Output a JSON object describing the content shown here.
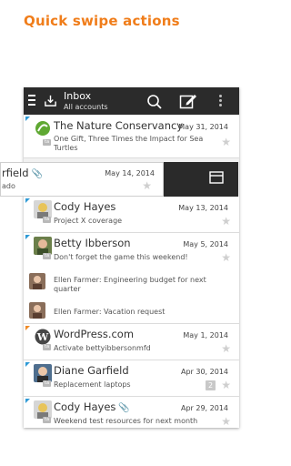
{
  "promo": {
    "title": "Quick swipe actions"
  },
  "topbar": {
    "title": "Inbox",
    "subtitle": "All accounts"
  },
  "swipe": {
    "sender": "rfield",
    "date": "May 14, 2014",
    "subject": "ado"
  },
  "messages": [
    {
      "sender": "The Nature Conservancy",
      "date": "May 31, 2014",
      "subject": "One Gift, Three Times the Impact for Sea Turtles"
    },
    {
      "sender": "Cody Hayes",
      "date": "May 13, 2014",
      "subject": "Project X coverage"
    },
    {
      "sender": "Betty Ibberson",
      "date": "May 5, 2014",
      "subject": "Don't forget the game this weekend!"
    },
    {
      "sender": "Ellen Farmer",
      "subject": "Ellen Farmer: Engineering budget for next quarter"
    },
    {
      "sender": "Ellen Farmer",
      "subject": "Ellen Farmer: Vacation request"
    },
    {
      "sender": "WordPress.com",
      "date": "May 1, 2014",
      "subject": "Activate bettyibbersonmfd"
    },
    {
      "sender": "Diane Garfield",
      "date": "Apr 30, 2014",
      "subject": "Replacement laptops",
      "count": "2"
    },
    {
      "sender": "Cody Hayes",
      "date": "Apr 29, 2014",
      "subject": "Weekend test resources for next month"
    }
  ]
}
